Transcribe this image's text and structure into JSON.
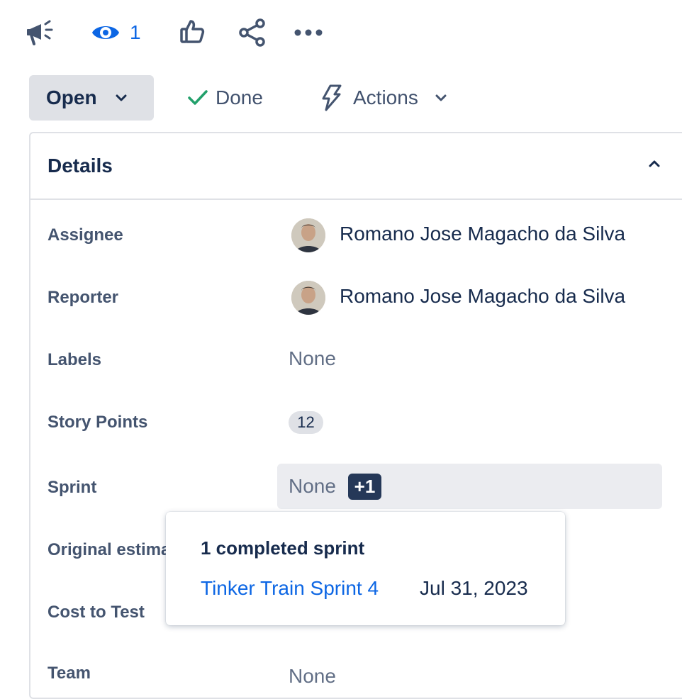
{
  "toolbar": {
    "icons": [
      "megaphone-icon",
      "eye-icon",
      "thumbs-up-icon",
      "share-icon",
      "more-icon"
    ],
    "watch_count": "1"
  },
  "status_row": {
    "status_label": "Open",
    "done_label": "Done",
    "actions_label": "Actions"
  },
  "details": {
    "title": "Details",
    "fields": {
      "assignee": {
        "label": "Assignee",
        "value": "Romano Jose Magacho da Silva"
      },
      "reporter": {
        "label": "Reporter",
        "value": "Romano Jose Magacho da Silva"
      },
      "labels": {
        "label": "Labels",
        "value": "None"
      },
      "story_points": {
        "label": "Story Points",
        "value": "12"
      },
      "sprint": {
        "label": "Sprint",
        "value": "None",
        "extra": "+1"
      },
      "original_estimate": {
        "label": "Original estima"
      },
      "cost_to_test": {
        "label": "Cost to Test"
      },
      "team": {
        "label": "Team",
        "value": "None"
      }
    }
  },
  "sprint_popup": {
    "title": "1 completed sprint",
    "sprint_name": "Tinker Train Sprint 4",
    "sprint_date": "Jul 31, 2023"
  },
  "colors": {
    "accent_blue": "#0c66e4",
    "done_green": "#22a06b",
    "text_dark": "#172b4d",
    "badge_dark": "#253858"
  }
}
